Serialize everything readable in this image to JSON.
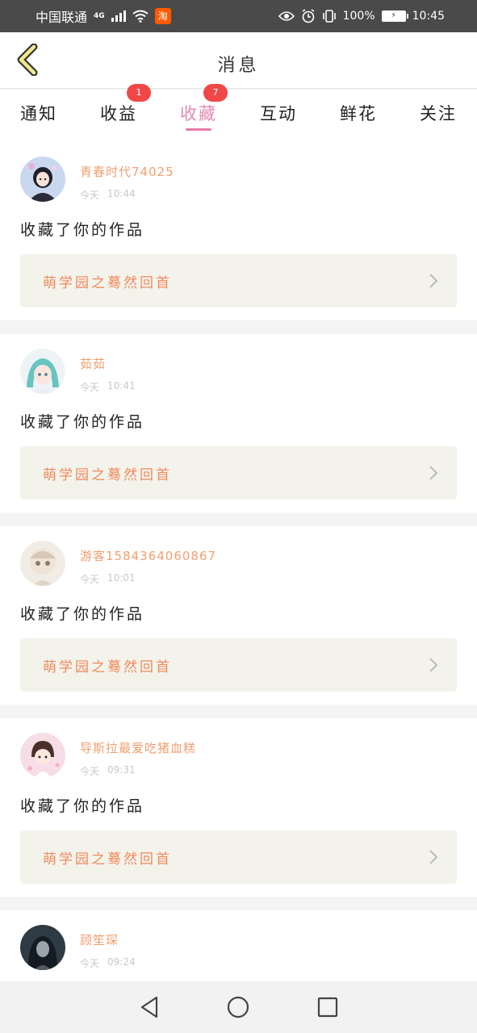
{
  "status_bar": {
    "carrier": "中国联通",
    "network": "4G",
    "battery_percent": "100%",
    "time": "10:45"
  },
  "header": {
    "title": "消息"
  },
  "tabs": [
    {
      "label": "通知",
      "badge": ""
    },
    {
      "label": "收益",
      "badge": "1"
    },
    {
      "label": "收藏",
      "badge": "7",
      "active": true
    },
    {
      "label": "互动",
      "badge": ""
    },
    {
      "label": "鲜花",
      "badge": ""
    },
    {
      "label": "关注",
      "badge": ""
    }
  ],
  "messages": [
    {
      "username": "青春时代74025",
      "date": "今天",
      "time": "10:44",
      "action": "收藏了你的作品",
      "work_title": "萌学园之蓦然回首"
    },
    {
      "username": "茹茹",
      "date": "今天",
      "time": "10:41",
      "action": "收藏了你的作品",
      "work_title": "萌学园之蓦然回首"
    },
    {
      "username": "游客1584364060867",
      "date": "今天",
      "time": "10:01",
      "action": "收藏了你的作品",
      "work_title": "萌学园之蓦然回首"
    },
    {
      "username": "导斯拉最爱吃猪血糕",
      "date": "今天",
      "time": "09:31",
      "action": "收藏了你的作品",
      "work_title": "萌学园之蓦然回首"
    },
    {
      "username": "顾笙琛",
      "date": "今天",
      "time": "09:24",
      "action": "",
      "work_title": ""
    }
  ],
  "colors": {
    "accent_pink": "#e48ab3",
    "username_orange": "#f0a070",
    "work_title_orange": "#f08a5d",
    "badge_red": "#f24747"
  }
}
